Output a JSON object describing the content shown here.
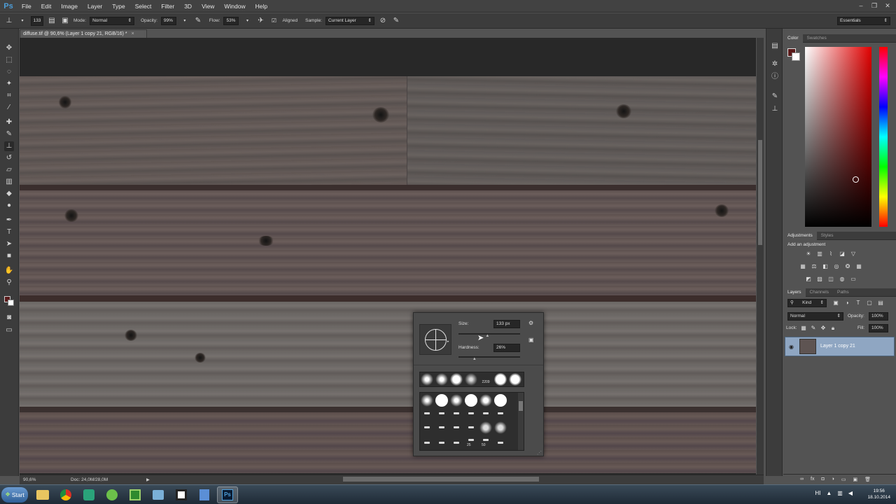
{
  "app": {
    "logo": "Ps"
  },
  "menu": [
    "File",
    "Edit",
    "Image",
    "Layer",
    "Type",
    "Select",
    "Filter",
    "3D",
    "View",
    "Window",
    "Help"
  ],
  "window_controls": [
    "–",
    "❐",
    "✕"
  ],
  "options_bar": {
    "brush_size": "133",
    "mode_label": "Mode:",
    "mode_value": "Normal",
    "opacity_label": "Opacity:",
    "opacity_value": "99%",
    "flow_label": "Flow:",
    "flow_value": "53%",
    "aligned_label": "Aligned",
    "sample_label": "Sample:",
    "sample_value": "Current Layer",
    "workspace": "Essentials"
  },
  "document": {
    "tab_title": "diffuse.tif @ 90,6% (Layer 1 copy 21, RGB/16) *",
    "zoom": "90,6%",
    "doc_info": "Doc: 24,0M/28,0M"
  },
  "brush_popup": {
    "size_label": "Size:",
    "size_value": "133 px",
    "hardness_label": "Hardness:",
    "hardness_value": "26%",
    "size_fraction": 0.47,
    "hardness_fraction": 0.26,
    "preset_labels": [
      "2209",
      "25",
      "50"
    ]
  },
  "color_panel": {
    "tabs": [
      "Color",
      "Swatches"
    ],
    "foreground": "#5a1a1a",
    "background": "#ffffff"
  },
  "adjustments_panel": {
    "tabs": [
      "Adjustments",
      "Styles"
    ],
    "heading": "Add an adjustment"
  },
  "layers_panel": {
    "tabs": [
      "Layers",
      "Channels",
      "Paths"
    ],
    "filter_kind": "Kind",
    "blend_mode": "Normal",
    "opacity_label": "Opacity:",
    "opacity_value": "100%",
    "lock_label": "Lock:",
    "fill_label": "Fill:",
    "fill_value": "100%",
    "layers": [
      {
        "name": "Layer 1 copy 21",
        "visible": true,
        "selected": true
      }
    ]
  },
  "taskbar": {
    "start_label": "Start",
    "tray_lang": "HI",
    "time": "19:56",
    "date": "18.10.2014"
  }
}
